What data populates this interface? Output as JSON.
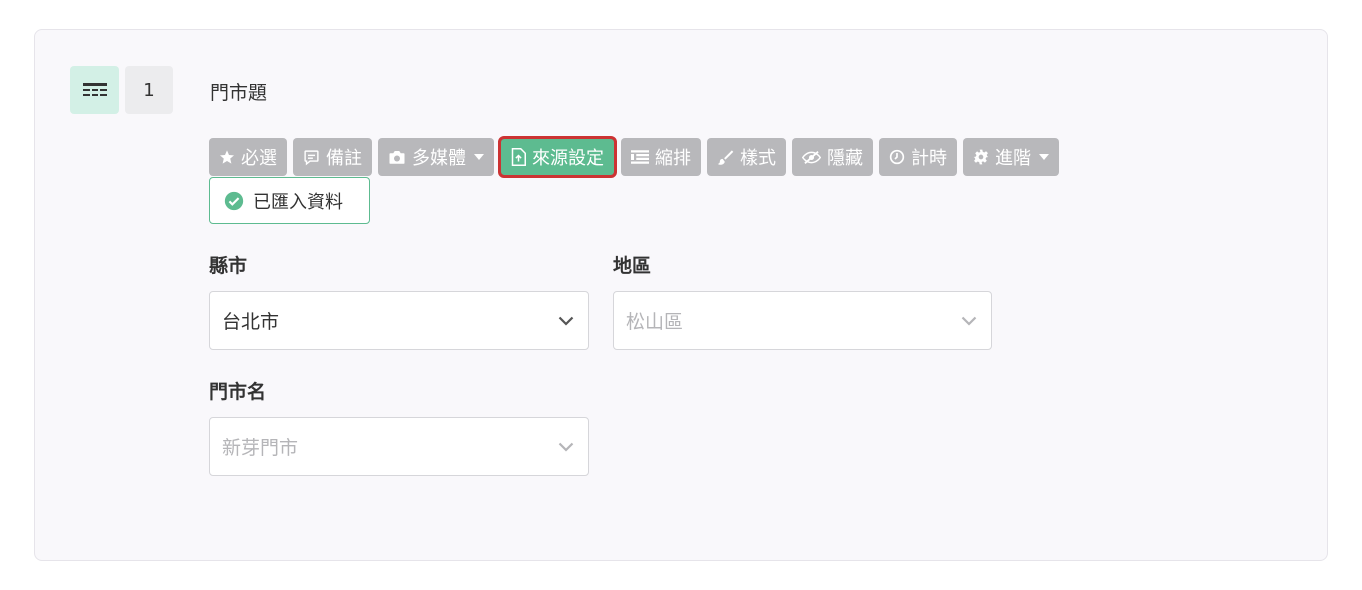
{
  "question": {
    "type_icon": "table-rows-icon",
    "number": "1",
    "title": "門市題"
  },
  "toolbar": {
    "buttons": [
      {
        "label": "必選",
        "icon": "star-icon"
      },
      {
        "label": "備註",
        "icon": "comment-icon"
      },
      {
        "label": "多媒體",
        "icon": "camera-icon"
      },
      {
        "label": "來源設定",
        "icon": "file-upload-icon"
      },
      {
        "label": "縮排",
        "icon": "indent-icon"
      },
      {
        "label": "樣式",
        "icon": "brush-icon"
      },
      {
        "label": "隱藏",
        "icon": "eye-slash-icon"
      },
      {
        "label": "計時",
        "icon": "clock-icon"
      },
      {
        "label": "進階",
        "icon": "gear-icon"
      }
    ],
    "active_color": "#5dbb90",
    "inactive_color": "#b8b8bb",
    "highlight_color": "#cc3333"
  },
  "imported_badge": {
    "label": "已匯入資料",
    "icon": "check-circle-icon",
    "color": "#5dbb90"
  },
  "fields": {
    "county": {
      "label": "縣市",
      "value": "台北市"
    },
    "district": {
      "label": "地區",
      "placeholder": "松山區"
    },
    "store": {
      "label": "門市名",
      "placeholder": "新芽門市"
    }
  }
}
